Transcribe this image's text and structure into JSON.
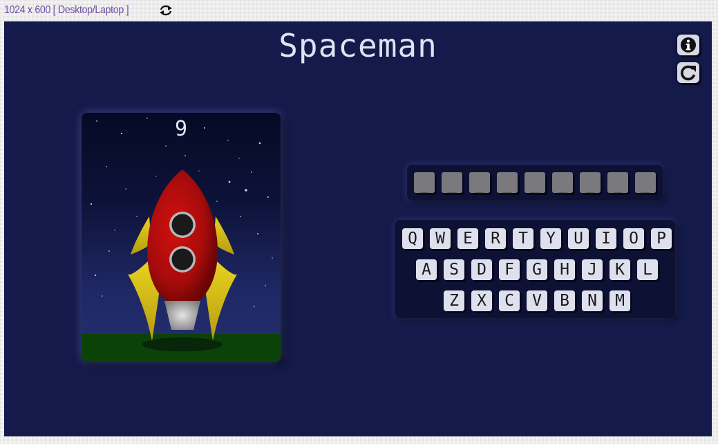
{
  "viewport_label": "1024 x 600 [ Desktop/Laptop ]",
  "title": "Spaceman",
  "guesses_remaining": "9",
  "word_slots": [
    "_",
    "_",
    "_",
    "_",
    "_",
    "_",
    "_",
    "_",
    "_"
  ],
  "keyboard": {
    "row1": [
      "Q",
      "W",
      "E",
      "R",
      "T",
      "Y",
      "U",
      "I",
      "O",
      "P"
    ],
    "row2": [
      "A",
      "S",
      "D",
      "F",
      "G",
      "H",
      "J",
      "K",
      "L"
    ],
    "row3": [
      "Z",
      "X",
      "C",
      "V",
      "B",
      "N",
      "M"
    ]
  },
  "icons": {
    "rotate": "rotate-icon",
    "info": "info-icon",
    "restart": "restart-icon"
  },
  "colors": {
    "background": "#141a4a",
    "title": "#dfe2f2",
    "key": "#dfe0ee",
    "slot": "#7a7a7e",
    "rocket_body": "#b30d0d",
    "rocket_fins": "#d9c21a",
    "ground": "#0a4208"
  }
}
